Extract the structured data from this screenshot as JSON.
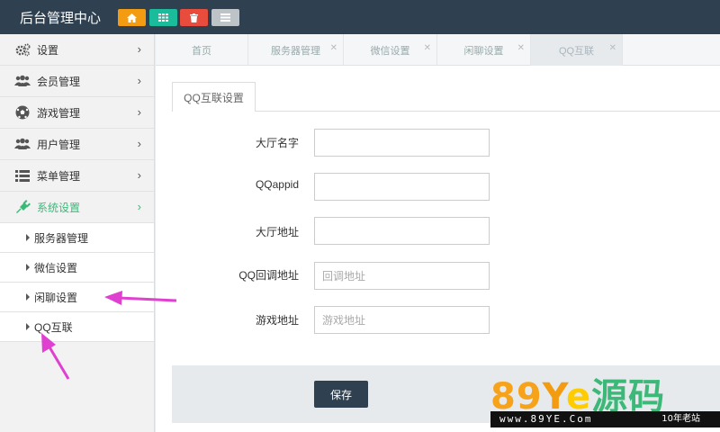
{
  "app": {
    "title": "后台管理中心"
  },
  "toolbar": [
    {
      "icon": "home-icon",
      "color": "#f39c12"
    },
    {
      "icon": "grid-icon",
      "color": "#1abc9c"
    },
    {
      "icon": "trash-icon",
      "color": "#e74c3c"
    },
    {
      "icon": "list-icon",
      "color": "#bdc3c7"
    }
  ],
  "sidebar": {
    "items": [
      {
        "label": "设置",
        "icon": "gears-icon"
      },
      {
        "label": "会员管理",
        "icon": "users-icon"
      },
      {
        "label": "游戏管理",
        "icon": "soccer-ball-icon"
      },
      {
        "label": "用户管理",
        "icon": "users-icon"
      },
      {
        "label": "菜单管理",
        "icon": "list-icon"
      },
      {
        "label": "系统设置",
        "icon": "plug-icon",
        "active": true
      }
    ],
    "subitems": [
      {
        "label": "服务器管理"
      },
      {
        "label": "微信设置"
      },
      {
        "label": "闲聊设置"
      },
      {
        "label": "QQ互联"
      }
    ]
  },
  "tabs": [
    {
      "label": "首页"
    },
    {
      "label": "服务器管理"
    },
    {
      "label": "微信设置"
    },
    {
      "label": "闲聊设置"
    },
    {
      "label": "QQ互联",
      "active": true
    }
  ],
  "form": {
    "tab_label": "QQ互联设置",
    "fields": [
      {
        "label": "大厅名字",
        "placeholder": "",
        "value": ""
      },
      {
        "label": "QQappid",
        "placeholder": "",
        "value": ""
      },
      {
        "label": "大厅地址",
        "placeholder": "",
        "value": ""
      },
      {
        "label": "QQ回调地址",
        "placeholder": "回调地址",
        "value": ""
      },
      {
        "label": "游戏地址",
        "placeholder": "游戏地址",
        "value": ""
      }
    ],
    "save_label": "保存"
  },
  "watermark": {
    "logo_text": "89Ye源码",
    "url": "www.89YE.Com",
    "tagline": "10年老站"
  },
  "colors": {
    "topbar": "#2f4050",
    "accent": "#3cb878",
    "annotation": "#e040d0"
  }
}
